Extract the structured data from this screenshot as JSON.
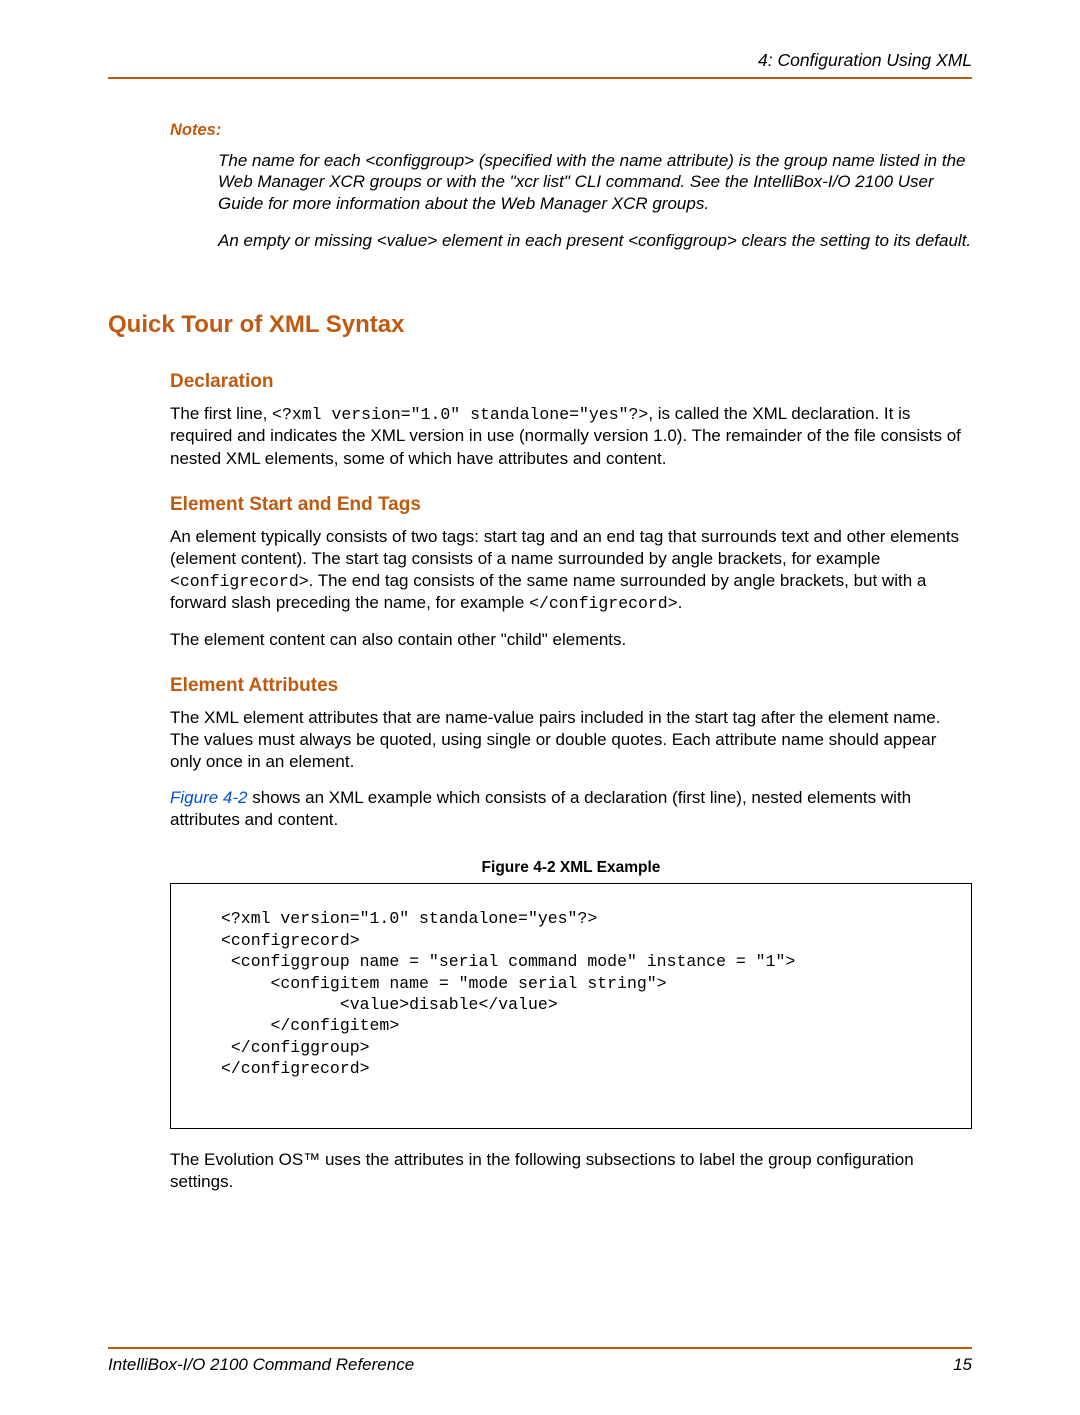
{
  "header": {
    "chapter": "4: Configuration Using XML"
  },
  "notes": {
    "label": "Notes:",
    "items": [
      "The name for each <configgroup> (specified with the name attribute) is the group name listed in the Web Manager XCR groups or with the \"xcr list\" CLI command. See the IntelliBox-I/O 2100 User Guide for more information about the Web Manager XCR groups.",
      "An empty or missing <value> element in each present <configgroup> clears the setting to its default."
    ]
  },
  "section": {
    "title": "Quick Tour of XML Syntax"
  },
  "declaration": {
    "heading": "Declaration",
    "p1_a": "The first line, ",
    "p1_code": "<?xml version=\"1.0\" standalone=\"yes\"?>",
    "p1_b": ", is called the XML declaration. It is required and indicates the XML version in use (normally version 1.0). The remainder of the file consists of nested XML elements, some of which have attributes and content."
  },
  "tags": {
    "heading": "Element Start and End Tags",
    "p1_a": "An element typically consists of two tags: start tag and an end tag that surrounds text and other elements (element content). The start tag consists of a name surrounded by angle brackets, for example ",
    "p1_code1": "<configrecord>",
    "p1_b": ". The end tag consists of the same name surrounded by angle brackets, but with a forward slash preceding the name, for example ",
    "p1_code2": "</configrecord>",
    "p1_c": ".",
    "p2": "The element content can also contain other \"child\" elements."
  },
  "attrs": {
    "heading": "Element Attributes",
    "p1": "The XML element attributes that are name-value pairs included in the start tag after the element name.  The values must always be quoted, using single or double quotes. Each attribute name should appear only once in an element.",
    "p2_link": "Figure 4-2",
    "p2_rest": " shows an XML example which consists of a declaration (first line), nested elements with attributes and content."
  },
  "figure": {
    "caption": "Figure 4-2  XML Example",
    "code": "<?xml version=\"1.0\" standalone=\"yes\"?>\n<configrecord>\n <configgroup name = \"serial command mode\" instance = \"1\">\n     <configitem name = \"mode serial string\">\n            <value>disable</value>\n     </configitem>\n </configgroup>\n</configrecord>"
  },
  "closing": {
    "p": "The Evolution OS™ uses the attributes in the following subsections to label the group configuration settings."
  },
  "footer": {
    "left": "IntelliBox-I/O 2100 Command Reference",
    "right": "15"
  }
}
